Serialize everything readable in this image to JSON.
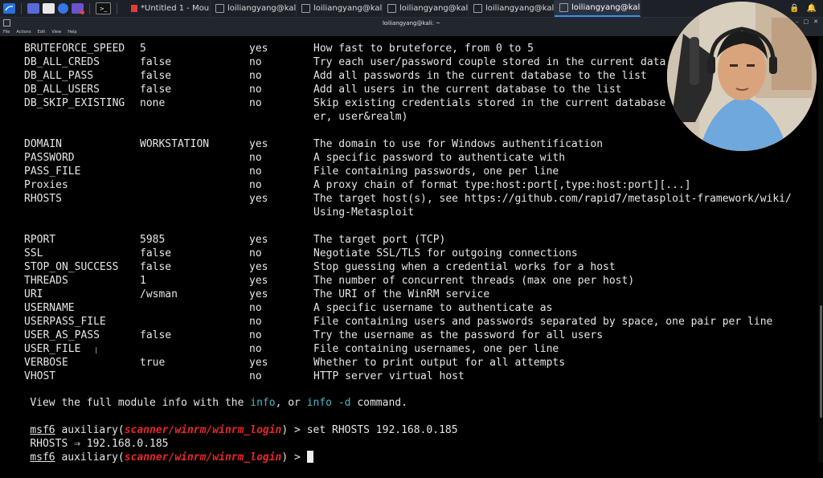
{
  "taskbar": {
    "tasks": [
      {
        "label": "*Untitled 1 - Mou..."
      },
      {
        "label": "loiliangyang@kali:..."
      },
      {
        "label": "loiliangyang@kali:..."
      },
      {
        "label": "loiliangyang@kali:..."
      },
      {
        "label": "loiliangyang@kali:..."
      },
      {
        "label": "loiliangyang@kali:..."
      }
    ]
  },
  "window": {
    "title": "loiliangyang@kali: ~",
    "menu": [
      "File",
      "Actions",
      "Edit",
      "View",
      "Help"
    ]
  },
  "options": [
    {
      "name": "BRUTEFORCE_SPEED",
      "setting": "5",
      "required": "yes",
      "desc": "How fast to bruteforce, from 0 to 5"
    },
    {
      "name": "DB_ALL_CREDS",
      "setting": "false",
      "required": "no",
      "desc": "Try each user/password couple stored in the current data"
    },
    {
      "name": "DB_ALL_PASS",
      "setting": "false",
      "required": "no",
      "desc": "Add all passwords in the current database to the list"
    },
    {
      "name": "DB_ALL_USERS",
      "setting": "false",
      "required": "no",
      "desc": "Add all users in the current database to the list"
    },
    {
      "name": "DB_SKIP_EXISTING",
      "setting": "none",
      "required": "no",
      "desc": "Skip existing credentials stored in the current database"
    },
    {
      "name": "",
      "setting": "",
      "required": "",
      "desc": "er, user&realm)"
    },
    {
      "name": "DOMAIN",
      "setting": "WORKSTATION",
      "required": "yes",
      "desc": "The domain to use for Windows authentification"
    },
    {
      "name": "PASSWORD",
      "setting": "",
      "required": "no",
      "desc": "A specific password to authenticate with"
    },
    {
      "name": "PASS_FILE",
      "setting": "",
      "required": "no",
      "desc": "File containing passwords, one per line"
    },
    {
      "name": "Proxies",
      "setting": "",
      "required": "no",
      "desc": "A proxy chain of format type:host:port[,type:host:port][...]"
    },
    {
      "name": "RHOSTS",
      "setting": "",
      "required": "yes",
      "desc": "The target host(s), see https://github.com/rapid7/metasploit-framework/wiki/"
    },
    {
      "name": "",
      "setting": "",
      "required": "",
      "desc": "Using-Metasploit"
    },
    {
      "name": "RPORT",
      "setting": "5985",
      "required": "yes",
      "desc": "The target port (TCP)"
    },
    {
      "name": "SSL",
      "setting": "false",
      "required": "no",
      "desc": "Negotiate SSL/TLS for outgoing connections"
    },
    {
      "name": "STOP_ON_SUCCESS",
      "setting": "false",
      "required": "yes",
      "desc": "Stop guessing when a credential works for a host"
    },
    {
      "name": "THREADS",
      "setting": "1",
      "required": "yes",
      "desc": "The number of concurrent threads (max one per host)"
    },
    {
      "name": "URI",
      "setting": "/wsman",
      "required": "yes",
      "desc": "The URI of the WinRM service"
    },
    {
      "name": "USERNAME",
      "setting": "",
      "required": "no",
      "desc": "A specific username to authenticate as"
    },
    {
      "name": "USERPASS_FILE",
      "setting": "",
      "required": "no",
      "desc": "File containing users and passwords separated by space, one pair per line"
    },
    {
      "name": "USER_AS_PASS",
      "setting": "false",
      "required": "no",
      "desc": "Try the username as the password for all users"
    },
    {
      "name": "USER_FILE",
      "setting": "",
      "required": "no",
      "desc": "File containing usernames, one per line"
    },
    {
      "name": "VERBOSE",
      "setting": "true",
      "required": "yes",
      "desc": "Whether to print output for all attempts"
    },
    {
      "name": "VHOST",
      "setting": "",
      "required": "no",
      "desc": "HTTP server virtual host"
    }
  ],
  "info_line": {
    "prefix": "View the full module info with the ",
    "cmd1": "info",
    "mid": ", or ",
    "cmd2": "info -d",
    "suffix": " command."
  },
  "prompt": {
    "msf": "msf6",
    "aux": " auxiliary(",
    "module": "scanner/winrm/winrm_login",
    "close": ") > "
  },
  "commands": {
    "set_cmd": "set RHOSTS 192.168.0.185",
    "result": "RHOSTS ⇒ 192.168.0.185"
  }
}
